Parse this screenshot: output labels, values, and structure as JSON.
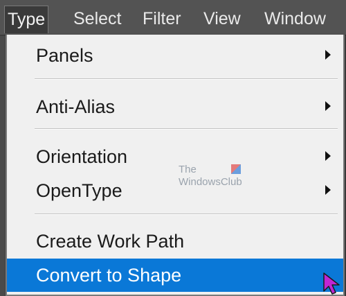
{
  "menubar": {
    "items": [
      {
        "label": "Type"
      },
      {
        "label": "Select"
      },
      {
        "label": "Filter"
      },
      {
        "label": "View"
      },
      {
        "label": "Window"
      }
    ]
  },
  "dropdown": {
    "items": [
      {
        "label": "Panels"
      },
      {
        "label": "Anti-Alias"
      },
      {
        "label": "Orientation"
      },
      {
        "label": "OpenType"
      },
      {
        "label": "Create Work Path"
      },
      {
        "label": "Convert to Shape"
      }
    ]
  },
  "watermark": {
    "line1": "The",
    "line2": "WindowsClub"
  },
  "colors": {
    "menubar_bg": "#535353",
    "menu_bg": "#f0f0f0",
    "highlight": "#0a78d7",
    "cursor": "#c026d3"
  }
}
